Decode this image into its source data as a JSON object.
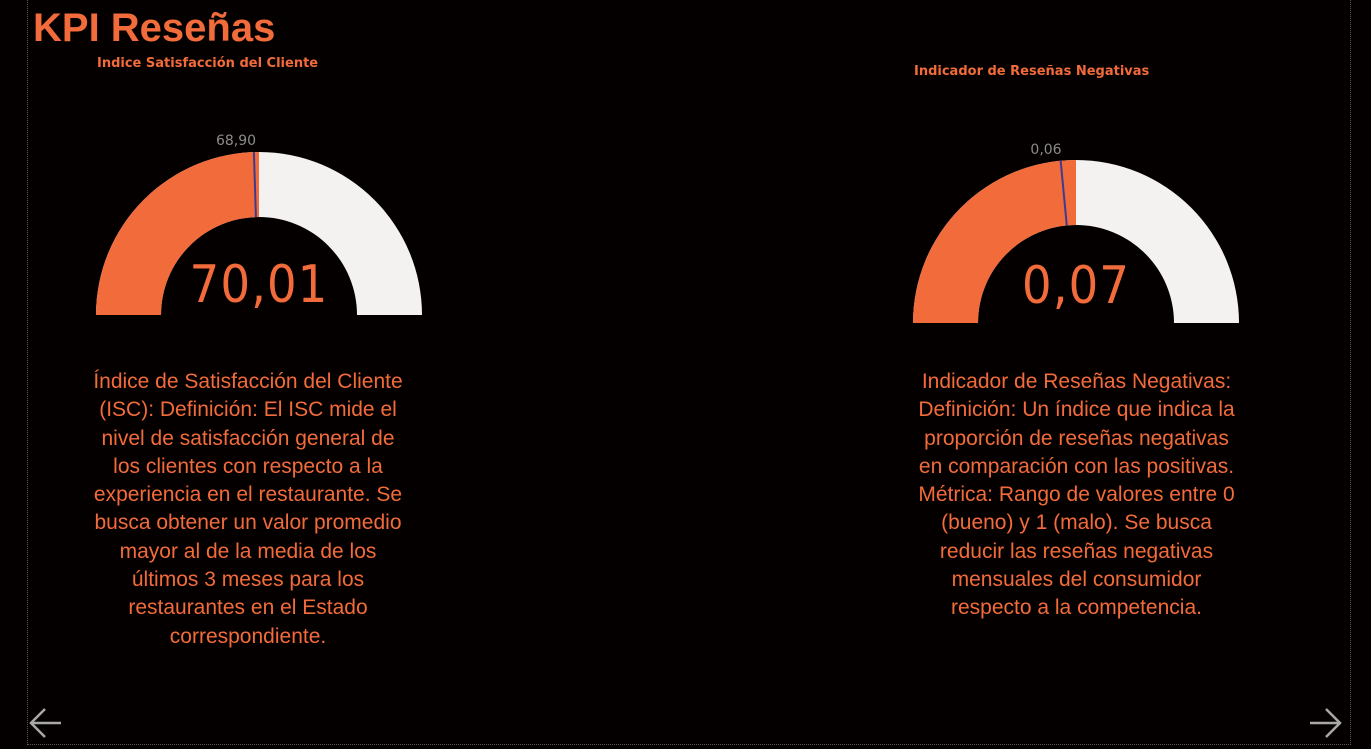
{
  "page": {
    "title": "KPI Reseñas"
  },
  "colors": {
    "background": "#050000",
    "accent": "#f26b3a",
    "gauge_track": "#f3f2f0",
    "target_line": "#3b3b8f",
    "muted_text": "#8c8c8c"
  },
  "gauges": [
    {
      "title": "Indice Satisfacción del Cliente",
      "value_label": "70,01",
      "target_label": "68,90",
      "fill_fraction": 0.5,
      "target_fraction": 0.49,
      "description": "Índice de Satisfacción del Cliente (ISC): Definición: El ISC mide el nivel de satisfacción general de los clientes con respecto a la experiencia en el restaurante. Se busca obtener un valor promedio mayor al de la media de los últimos 3 meses para los restaurantes en el Estado correspondiente."
    },
    {
      "title": "Indicador de Reseñas Negativas",
      "value_label": "0,07",
      "target_label": "0,06",
      "fill_fraction": 0.5,
      "target_fraction": 0.47,
      "description": "Indicador de Reseñas Negativas: Definición: Un índice que indica la proporción de reseñas negativas en comparación con las positivas. Métrica: Rango de valores entre 0 (bueno) y 1 (malo). Se busca reducir las reseñas negativas mensuales del consumidor respecto a la competencia."
    }
  ],
  "navigation": {
    "previous_icon": "arrow-left-icon",
    "next_icon": "arrow-right-icon"
  }
}
